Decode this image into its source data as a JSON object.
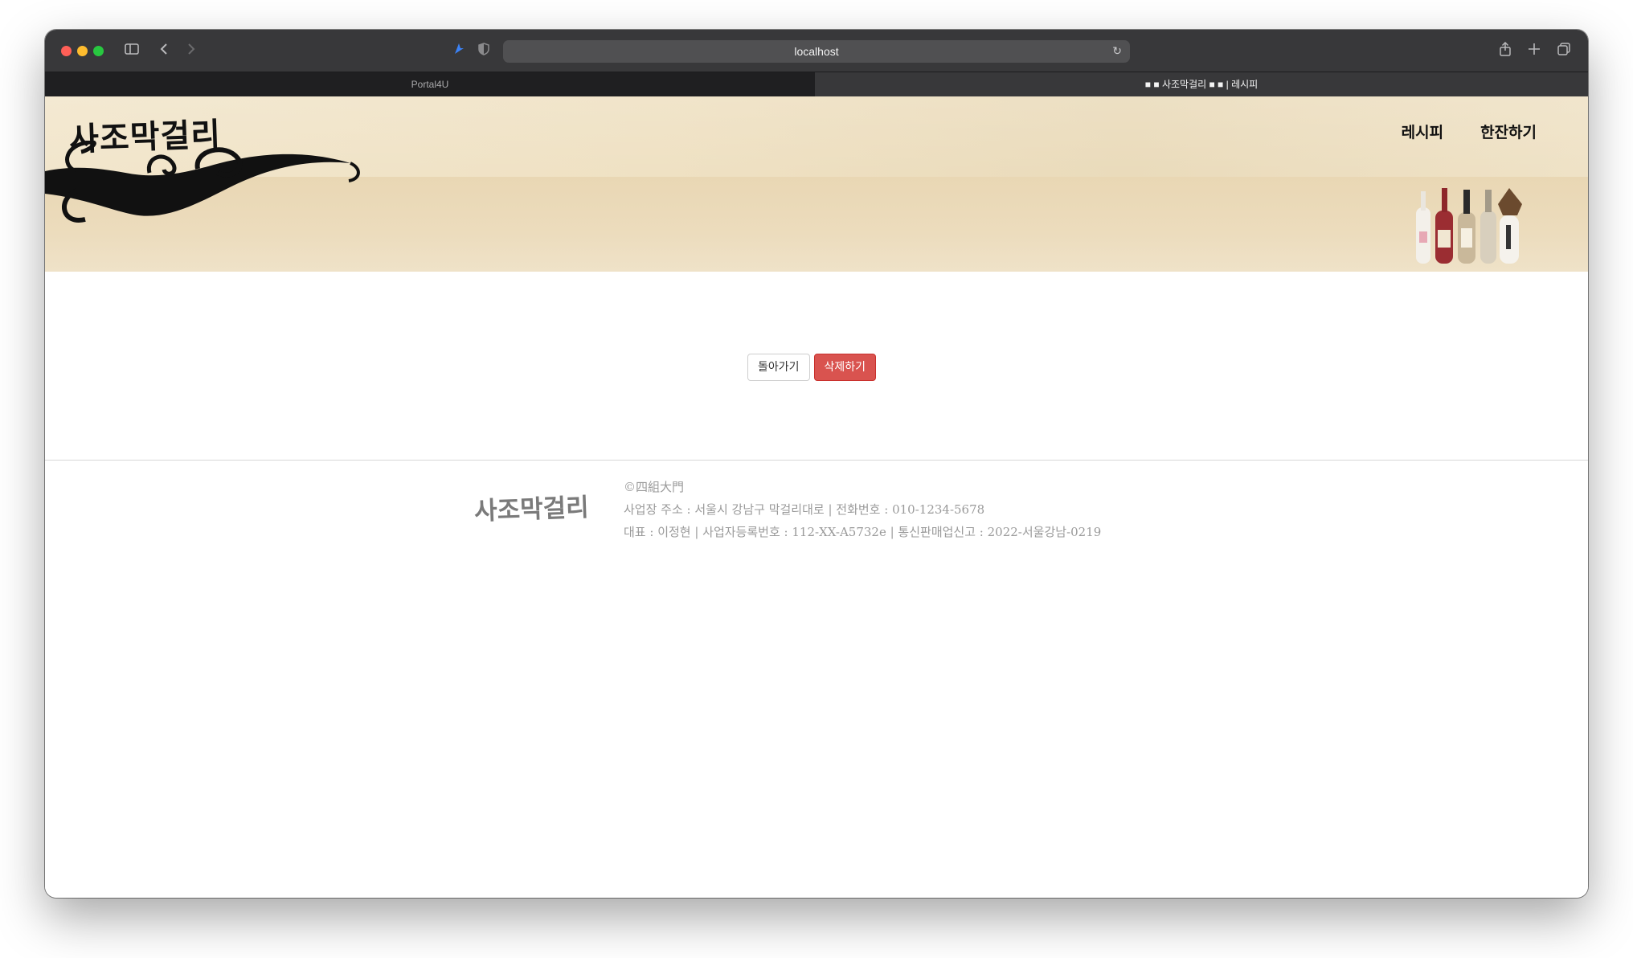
{
  "browser": {
    "url": "localhost",
    "tabs": [
      {
        "label": "Portal4U",
        "active": false
      },
      {
        "label": "■ ■ 사조막걸리 ■ ■ | 레시피",
        "active": true
      }
    ]
  },
  "header": {
    "logo_text": "사조막걸리",
    "nav": [
      {
        "label": "레시피"
      },
      {
        "label": "한잔하기"
      }
    ]
  },
  "actions": {
    "back_label": "돌아가기",
    "delete_label": "삭제하기"
  },
  "footer": {
    "logo_text": "사조막걸리",
    "copyright": "©四組大門",
    "address_line": "사업장 주소 : 서울시 강남구 막걸리대로 | 전화번호 : 010-1234-5678",
    "registration_line": "대표 : 이정현 | 사업자등록번호 : 112-XX-A5732e | 통신판매업신고 : 2022-서울강남-0219"
  },
  "colors": {
    "delete_button": "#d9534f",
    "header_beige": "#efe1c3"
  }
}
